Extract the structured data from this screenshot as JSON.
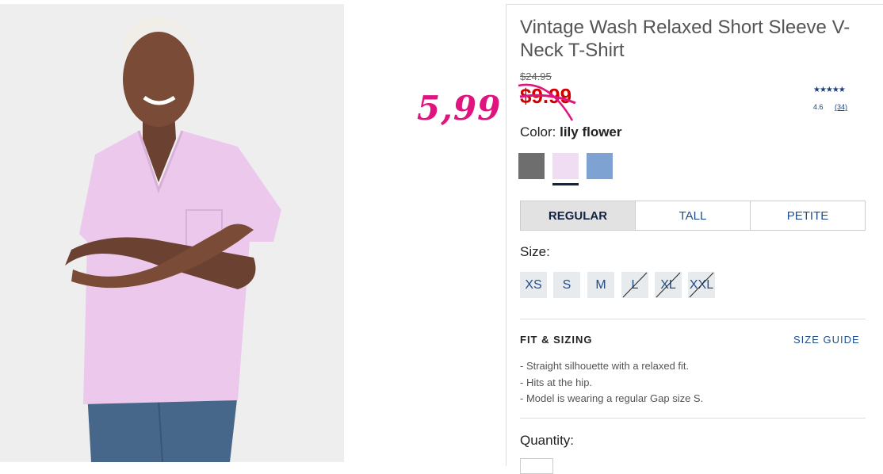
{
  "product": {
    "title": "Vintage Wash Relaxed Short Sleeve V-Neck T-Shirt",
    "original_price": "$24.95",
    "sale_price": "$9.99",
    "annotation": "5,99",
    "rating": {
      "stars": "★★★★★",
      "score": "4.6",
      "count": "(34)"
    },
    "color_label": "Color:",
    "color_value": "lily flower",
    "swatches": [
      {
        "name": "charcoal",
        "color": "#6e6e6e"
      },
      {
        "name": "lily flower",
        "color": "#f1ddf3",
        "selected": true
      },
      {
        "name": "blue",
        "color": "#7ea3d3"
      }
    ],
    "fits": [
      "REGULAR",
      "TALL",
      "PETITE"
    ],
    "size_label": "Size:",
    "sizes": [
      {
        "label": "XS",
        "available": true
      },
      {
        "label": "S",
        "available": true
      },
      {
        "label": "M",
        "available": true
      },
      {
        "label": "L",
        "available": false
      },
      {
        "label": "XL",
        "available": false
      },
      {
        "label": "XXL",
        "available": false
      }
    ],
    "fit_heading": "FIT & SIZING",
    "size_guide": "SIZE GUIDE",
    "fit_bullets": [
      "- Straight silhouette with a relaxed fit.",
      "- Hits at the hip.",
      "- Model is wearing a regular Gap size S."
    ],
    "quantity_label": "Quantity:"
  },
  "colors": {
    "accent": "#1f4e8c",
    "sale": "#d00000",
    "annotation": "#e0147e",
    "shirt": "#ecc9ec"
  }
}
